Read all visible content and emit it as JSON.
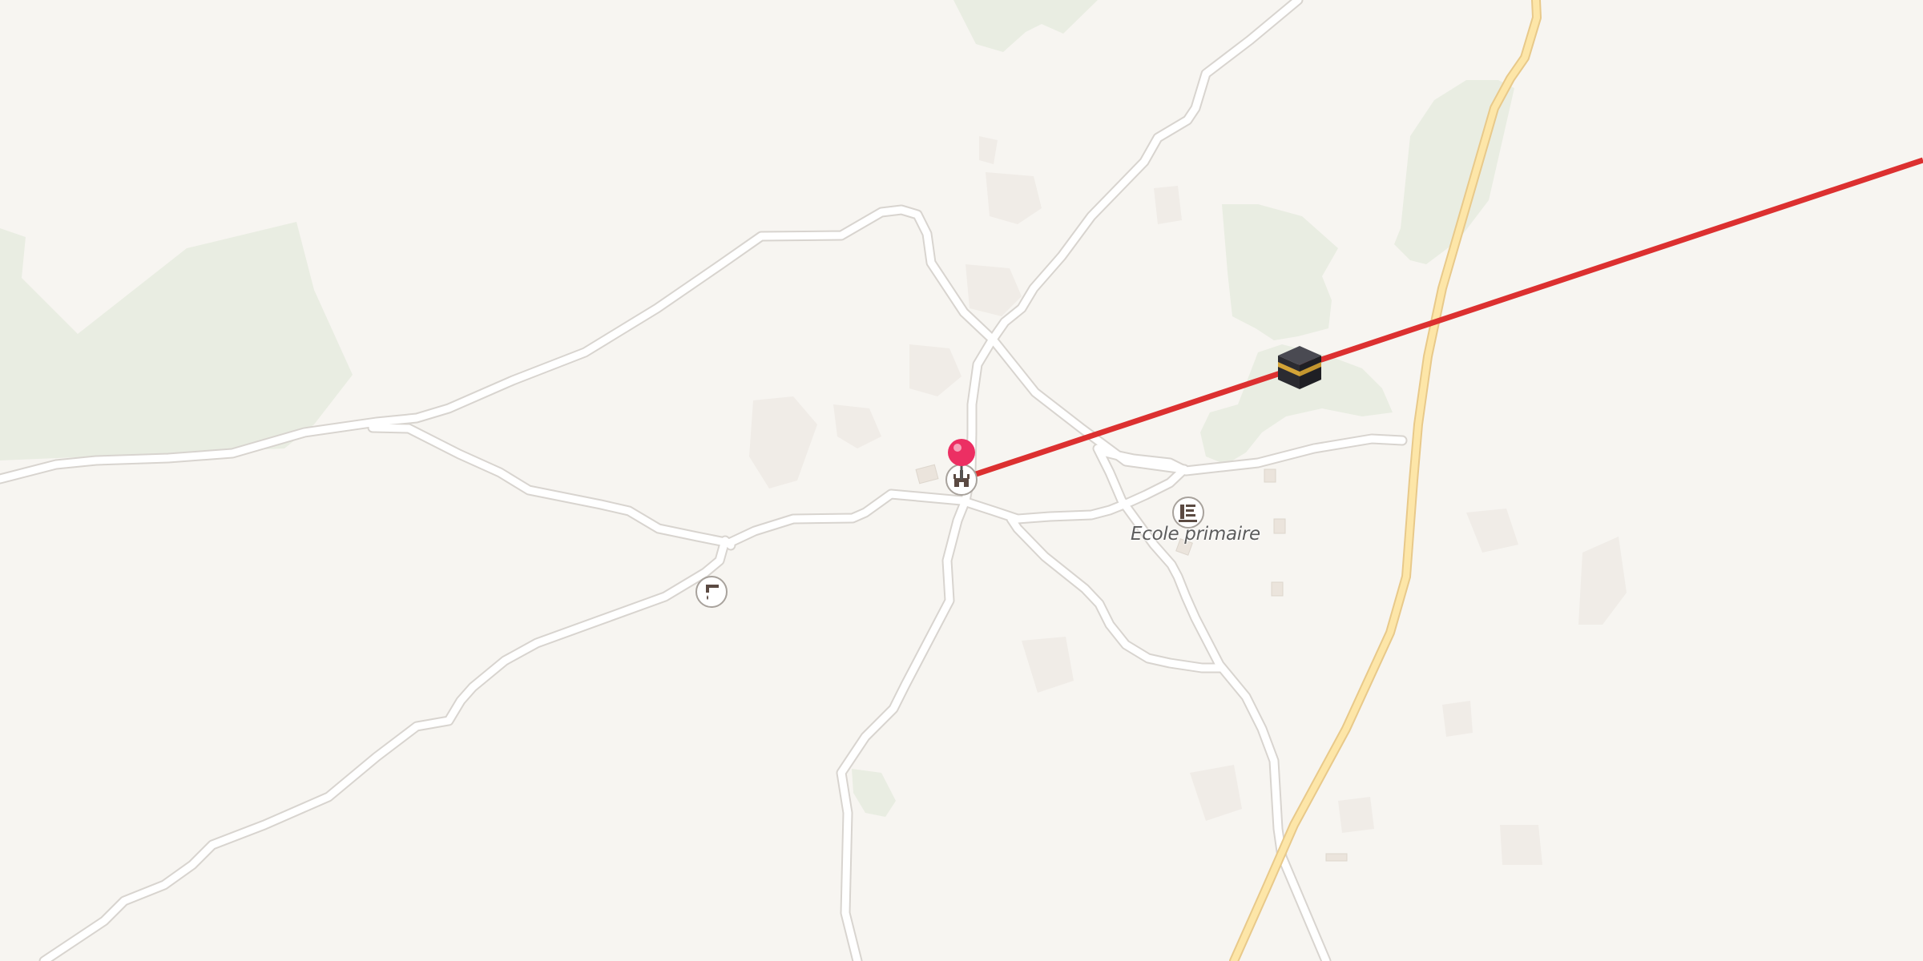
{
  "map": {
    "poi_label_school": "Ecole primaire",
    "colors": {
      "background": "#f7f5f1",
      "vegetation": "#e9ede2",
      "building": "#efeae4",
      "minor_road_casing": "#d8d4cf",
      "minor_road": "#ffffff",
      "major_road_casing": "#e8c98a",
      "major_road": "#fde6a8",
      "qibla_line": "#dc3030",
      "location_pin": "#ec2f63",
      "poi_icon": "#5b4a42"
    },
    "icons": {
      "location_pin": "location-pin-icon",
      "mosque": "mosque-icon",
      "school": "school-icon",
      "water_tap": "water-tap-icon",
      "kaaba": "kaaba-icon"
    }
  }
}
